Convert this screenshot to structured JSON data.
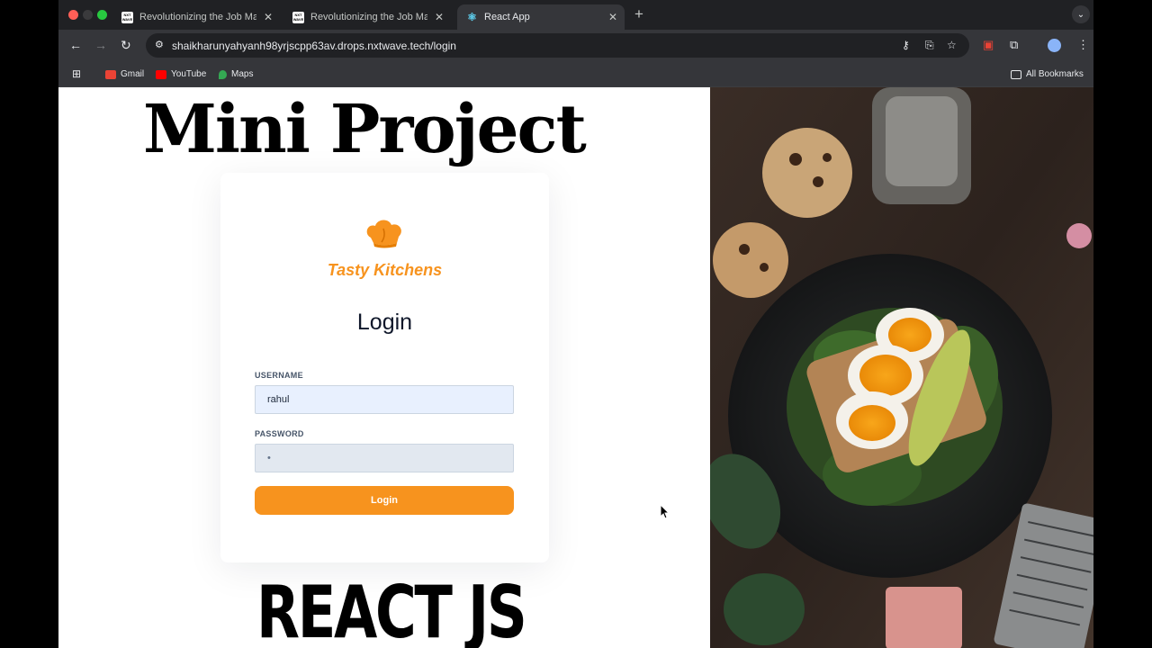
{
  "tabs": [
    {
      "title": "Revolutionizing the Job Market",
      "favicon_text": "NXT WAVE"
    },
    {
      "title": "Revolutionizing the Job Market",
      "favicon_text": "NXT WAVE"
    },
    {
      "title": "React App",
      "favicon": "react-icon"
    }
  ],
  "address_bar": {
    "url": "shaikharunyahyanh98yrjscpp63av.drops.nxtwave.tech/login"
  },
  "bookmarks": {
    "items": [
      {
        "label": "Gmail",
        "icon": "gmail-icon"
      },
      {
        "label": "YouTube",
        "icon": "youtube-icon"
      },
      {
        "label": "Maps",
        "icon": "maps-icon"
      }
    ],
    "all_bookmarks": "All Bookmarks"
  },
  "overlay": {
    "title": "Mini Project",
    "subtitle": "REACT JS"
  },
  "login": {
    "brand": "Tasty Kitchens",
    "heading": "Login",
    "username_label": "USERNAME",
    "username_value": "rahul",
    "password_label": "PASSWORD",
    "password_value": "•",
    "button_label": "Login"
  },
  "colors": {
    "accent": "#f7931e",
    "input_autofill": "#e8f0fe",
    "password_bg": "#e2e8f0"
  }
}
